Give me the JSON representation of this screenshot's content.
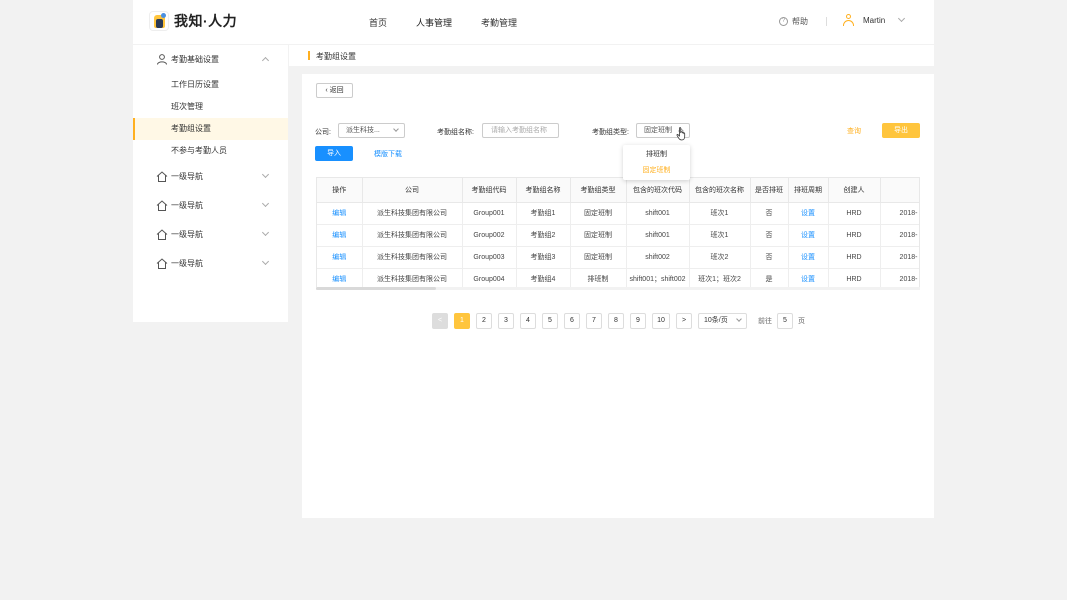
{
  "header": {
    "logo_text": "我知·人力",
    "nav": [
      "首页",
      "人事管理",
      "考勤管理"
    ],
    "help_label": "帮助",
    "user_name": "Martin"
  },
  "sidebar": {
    "group_main": "考勤基础设置",
    "sub_items": [
      "工作日历设置",
      "班次管理",
      "考勤组设置",
      "不参与考勤人员"
    ],
    "nav_items": [
      "一级导航",
      "一级导航",
      "一级导航",
      "一级导航"
    ]
  },
  "breadcrumb": "考勤组设置",
  "toolbar": {
    "back_label": "返回",
    "company_label": "公司:",
    "company_value": "派生科技...",
    "group_name_label": "考勤组名称:",
    "group_name_placeholder": "请输入考勤组名称",
    "group_type_label": "考勤组类型:",
    "group_type_value": "固定班制",
    "query_label": "查询",
    "export_label": "导出",
    "import_label": "导入",
    "template_label": "模版下载"
  },
  "dropdown": {
    "options": [
      "排班制",
      "固定班制"
    ],
    "selected": "固定班制"
  },
  "table": {
    "headers": [
      "操作",
      "公司",
      "考勤组代码",
      "考勤组名称",
      "考勤组类型",
      "包含的班次代码",
      "包含的班次名称",
      "是否排班",
      "排班周期",
      "创建人",
      ""
    ],
    "rows": [
      [
        "编辑",
        "派生科技集团有限公司",
        "Group001",
        "考勤组1",
        "固定班制",
        "shift001",
        "班次1",
        "否",
        "设置",
        "HRD",
        "2018-"
      ],
      [
        "编辑",
        "派生科技集团有限公司",
        "Group002",
        "考勤组2",
        "固定班制",
        "shift001",
        "班次1",
        "否",
        "设置",
        "HRD",
        "2018-"
      ],
      [
        "编辑",
        "派生科技集团有限公司",
        "Group003",
        "考勤组3",
        "固定班制",
        "shift002",
        "班次2",
        "否",
        "设置",
        "HRD",
        "2018-"
      ],
      [
        "编辑",
        "派生科技集团有限公司",
        "Group004",
        "考勤组4",
        "排班制",
        "shift001；shift002",
        "班次1；班次2",
        "是",
        "设置",
        "HRD",
        "2018-"
      ]
    ]
  },
  "pagination": {
    "prev": "<",
    "pages": [
      "1",
      "2",
      "3",
      "4",
      "5",
      "6",
      "7",
      "8",
      "9",
      "10"
    ],
    "current": "1",
    "next": ">",
    "page_size": "10条/页",
    "jump_prefix": "前往",
    "jump_value": "5",
    "jump_suffix": "页"
  }
}
